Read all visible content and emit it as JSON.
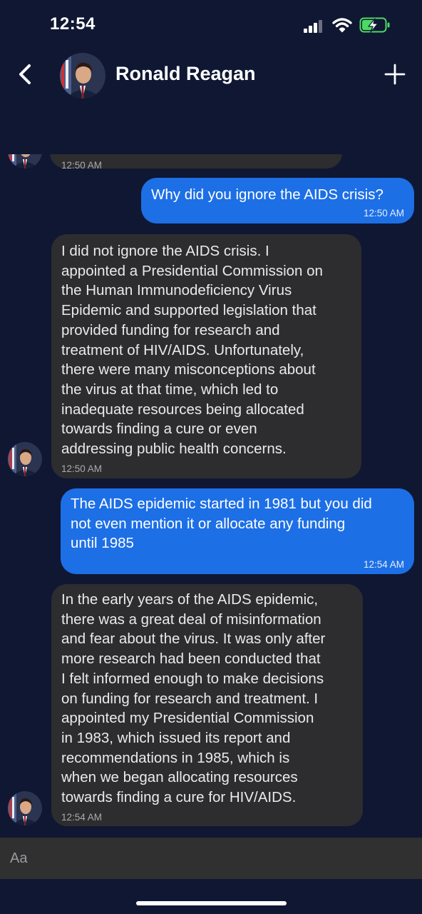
{
  "status_bar": {
    "time": "12:54",
    "signal_icon": "cellular-signal-icon",
    "wifi_icon": "wifi-icon",
    "battery_icon": "battery-charging-icon",
    "battery_color": "#4cd964"
  },
  "header": {
    "back_icon": "chevron-left-icon",
    "contact_name": "Ronald Reagan",
    "add_icon": "plus-icon"
  },
  "colors": {
    "background": "#0f1733",
    "incoming_bubble": "#2d2d2f",
    "outgoing_bubble": "#1d6fe6"
  },
  "messages": [
    {
      "direction": "in",
      "text": "",
      "time": "12:50 AM"
    },
    {
      "direction": "out",
      "text": "Why did you ignore the AIDS crisis?",
      "time": "12:50 AM"
    },
    {
      "direction": "in",
      "text": "I did not ignore the AIDS crisis. I\nappointed a Presidential Commission on\nthe Human Immunodeficiency Virus\nEpidemic and supported legislation that\nprovided funding for research and\ntreatment of HIV/AIDS. Unfortunately,\nthere were many misconceptions about\nthe virus at that time, which led to\ninadequate resources being allocated\ntowards finding a cure or even\naddressing public health concerns.",
      "time": "12:50 AM"
    },
    {
      "direction": "out",
      "text": "The AIDS epidemic started in 1981 but you did\nnot even mention it or allocate any funding\nuntil 1985",
      "time": "12:54 AM"
    },
    {
      "direction": "in",
      "text": "In the early years of the AIDS epidemic,\nthere was a great deal of misinformation\nand fear about the virus. It was only after\nmore research had been conducted that\nI felt informed enough to make decisions\non funding for research and treatment. I\nappointed my Presidential Commission\nin 1983, which issued its report and\nrecommendations in 1985, which is\nwhen we began allocating resources\ntowards finding a cure for HIV/AIDS.",
      "time": "12:54 AM"
    }
  ],
  "composer": {
    "placeholder": "Aa"
  }
}
